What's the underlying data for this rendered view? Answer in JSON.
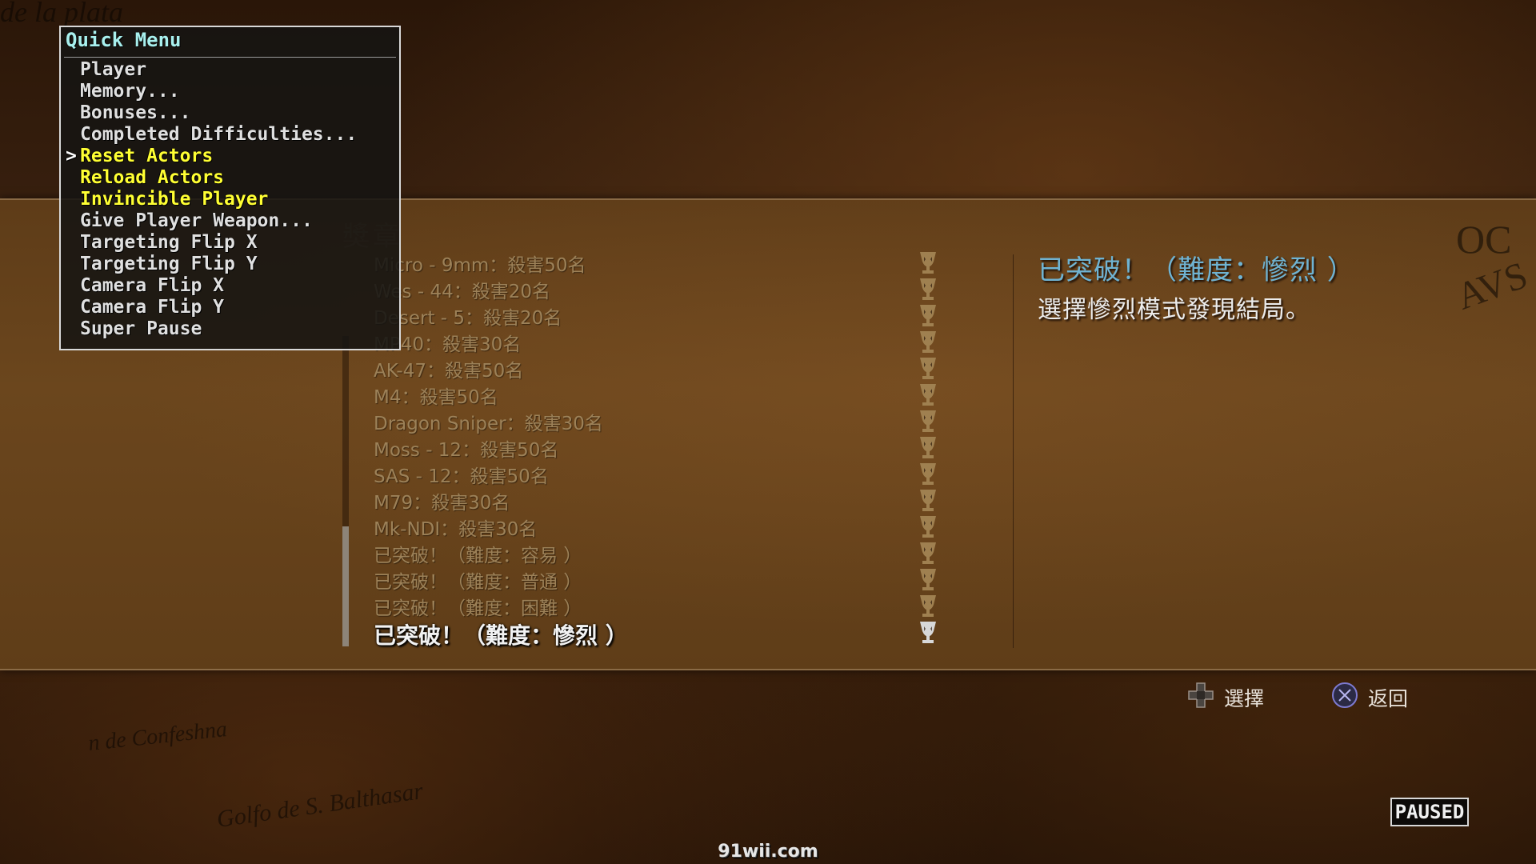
{
  "background": {
    "map_text": [
      "de la plata",
      "Golfo de S. Balthasar",
      "n de Confeshna",
      "OC",
      "AVS"
    ]
  },
  "quick_menu": {
    "title": "Quick Menu",
    "cursor": ">",
    "selected_index": 4,
    "items": [
      {
        "label": "Player",
        "highlight": false
      },
      {
        "label": "Memory...",
        "highlight": false
      },
      {
        "label": "Bonuses...",
        "highlight": false
      },
      {
        "label": "Completed Difficulties...",
        "highlight": false
      },
      {
        "label": "Reset Actors",
        "highlight": true
      },
      {
        "label": "Reload Actors",
        "highlight": true
      },
      {
        "label": "Invincible Player",
        "highlight": true
      },
      {
        "label": "Give Player Weapon...",
        "highlight": false
      },
      {
        "label": "Targeting Flip X",
        "highlight": false
      },
      {
        "label": "Targeting Flip Y",
        "highlight": false
      },
      {
        "label": "Camera Flip X",
        "highlight": false
      },
      {
        "label": "Camera Flip Y",
        "highlight": false
      },
      {
        "label": "Super Pause",
        "highlight": false
      }
    ],
    "colors": {
      "title": "#a8f0ee",
      "highlight": "#ffff33",
      "normal": "#e0e0e0"
    }
  },
  "medals": {
    "section_title": "獎章",
    "selected_index": 14,
    "scroll_position": 1.0,
    "items": [
      "Micro - 9mm：殺害50名",
      "Wes - 44：殺害20名",
      "Desert - 5：殺害20名",
      "MP40：殺害30名",
      "AK-47：殺害50名",
      "M4：殺害50名",
      "Dragon Sniper：殺害30名",
      "Moss - 12：殺害50名",
      "SAS - 12：殺害50名",
      "M79：殺害30名",
      "Mk-NDI：殺害30名",
      "已突破！（難度：容易 ）",
      "已突破！（難度：普通 ）",
      "已突破！（難度：困難 ）",
      "已突破！（難度：慘烈 ）"
    ],
    "detail": {
      "title": "已突破！（難度：慘烈 ）",
      "description": "選擇慘烈模式發現結局。"
    },
    "colors": {
      "item": "#9c8158",
      "selected": "#f2f2f2",
      "trophy": "#9f8050",
      "trophy_selected": "#d8d8d8",
      "detail_title": "#6fb3d2"
    }
  },
  "hints": {
    "select_label": "選擇",
    "back_label": "返回"
  },
  "status": {
    "paused_label": "PAUSED"
  },
  "watermark": "91wii.com"
}
